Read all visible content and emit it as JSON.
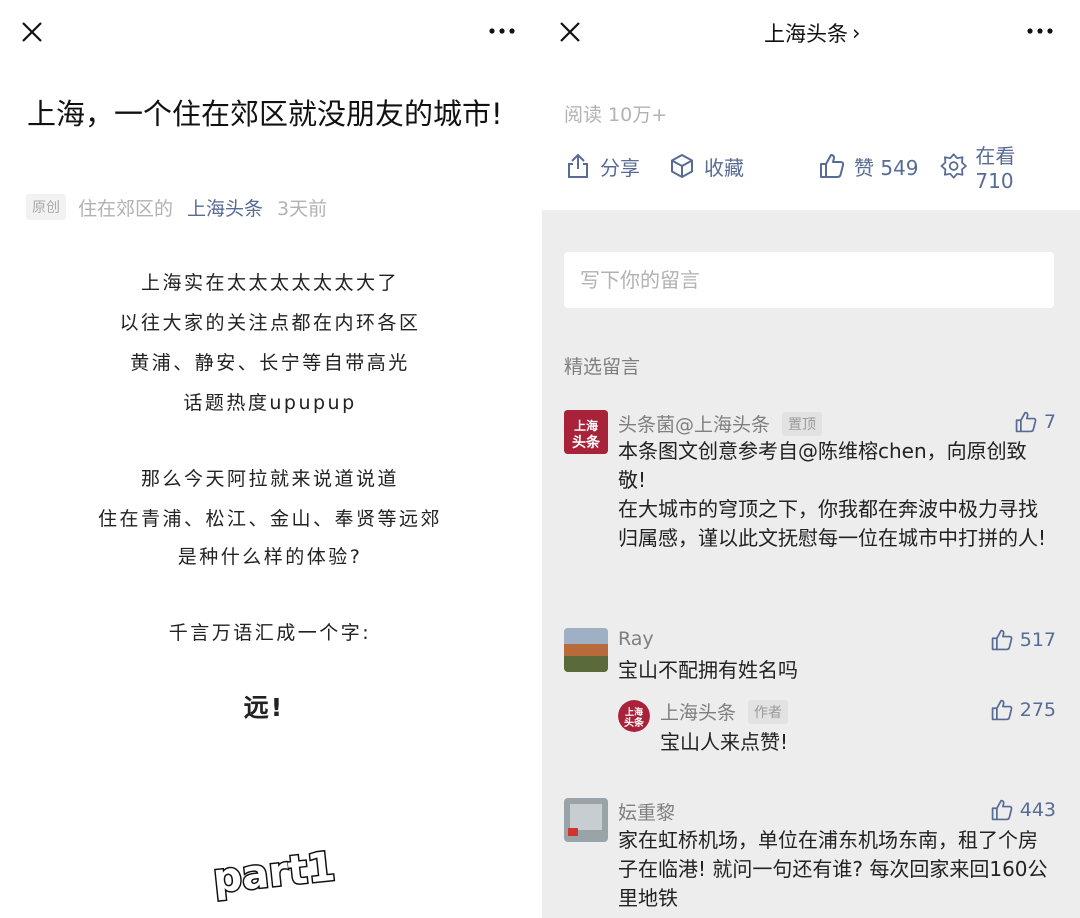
{
  "left": {
    "title": "上海，一个住在郊区就没朋友的城市!",
    "meta": {
      "badge": "原创",
      "author": "住在郊区的",
      "account": "上海头条",
      "time": "3天前"
    },
    "poem": [
      "上海实在太太太太太太大了",
      "以往大家的关注点都在内环各区",
      "黄浦、静安、长宁等自带高光",
      "话题热度upupup",
      "那么今天阿拉就来说道说道",
      "住在青浦、松江、金山、奉贤等远郊",
      "是种什么样的体验?",
      "千言万语汇成一个字:"
    ],
    "emphasis": "远!",
    "part_logo": "part1"
  },
  "right": {
    "account_title": "上海头条",
    "account_chevron": "›",
    "reads": "阅读 10万+",
    "actions": {
      "share": "分享",
      "collect": "收藏",
      "like": "赞 549",
      "watching": "在看 710"
    },
    "comment_placeholder": "写下你的留言",
    "featured_label": "精选留言",
    "comments": [
      {
        "name": "头条菌@上海头条",
        "tag": "置顶",
        "likes": "7",
        "avatar_text": "上海头条",
        "text": "本条图文创意参考自@陈维榕chen，向原创致敬!\n在大城市的穹顶之下，你我都在奔波中极力寻找归属感，谨以此文抚慰每一位在城市中打拼的人!"
      },
      {
        "name": "Ray",
        "likes": "517",
        "text": "宝山不配拥有姓名吗"
      },
      {
        "name": "上海头条",
        "tag": "作者",
        "likes": "275",
        "avatar_text": "上海头条",
        "text": "宝山人来点赞!"
      },
      {
        "name": "妘重黎",
        "likes": "443",
        "text": "家在虹桥机场，单位在浦东机场东南，租了个房子在临港! 就问一句还有谁? 每次回家来回160公里地铁"
      }
    ]
  },
  "colors": {
    "link": "#576b95",
    "muted": "#b2b2b2",
    "comment_bg": "#ededed",
    "brand_red": "#a8223a"
  }
}
